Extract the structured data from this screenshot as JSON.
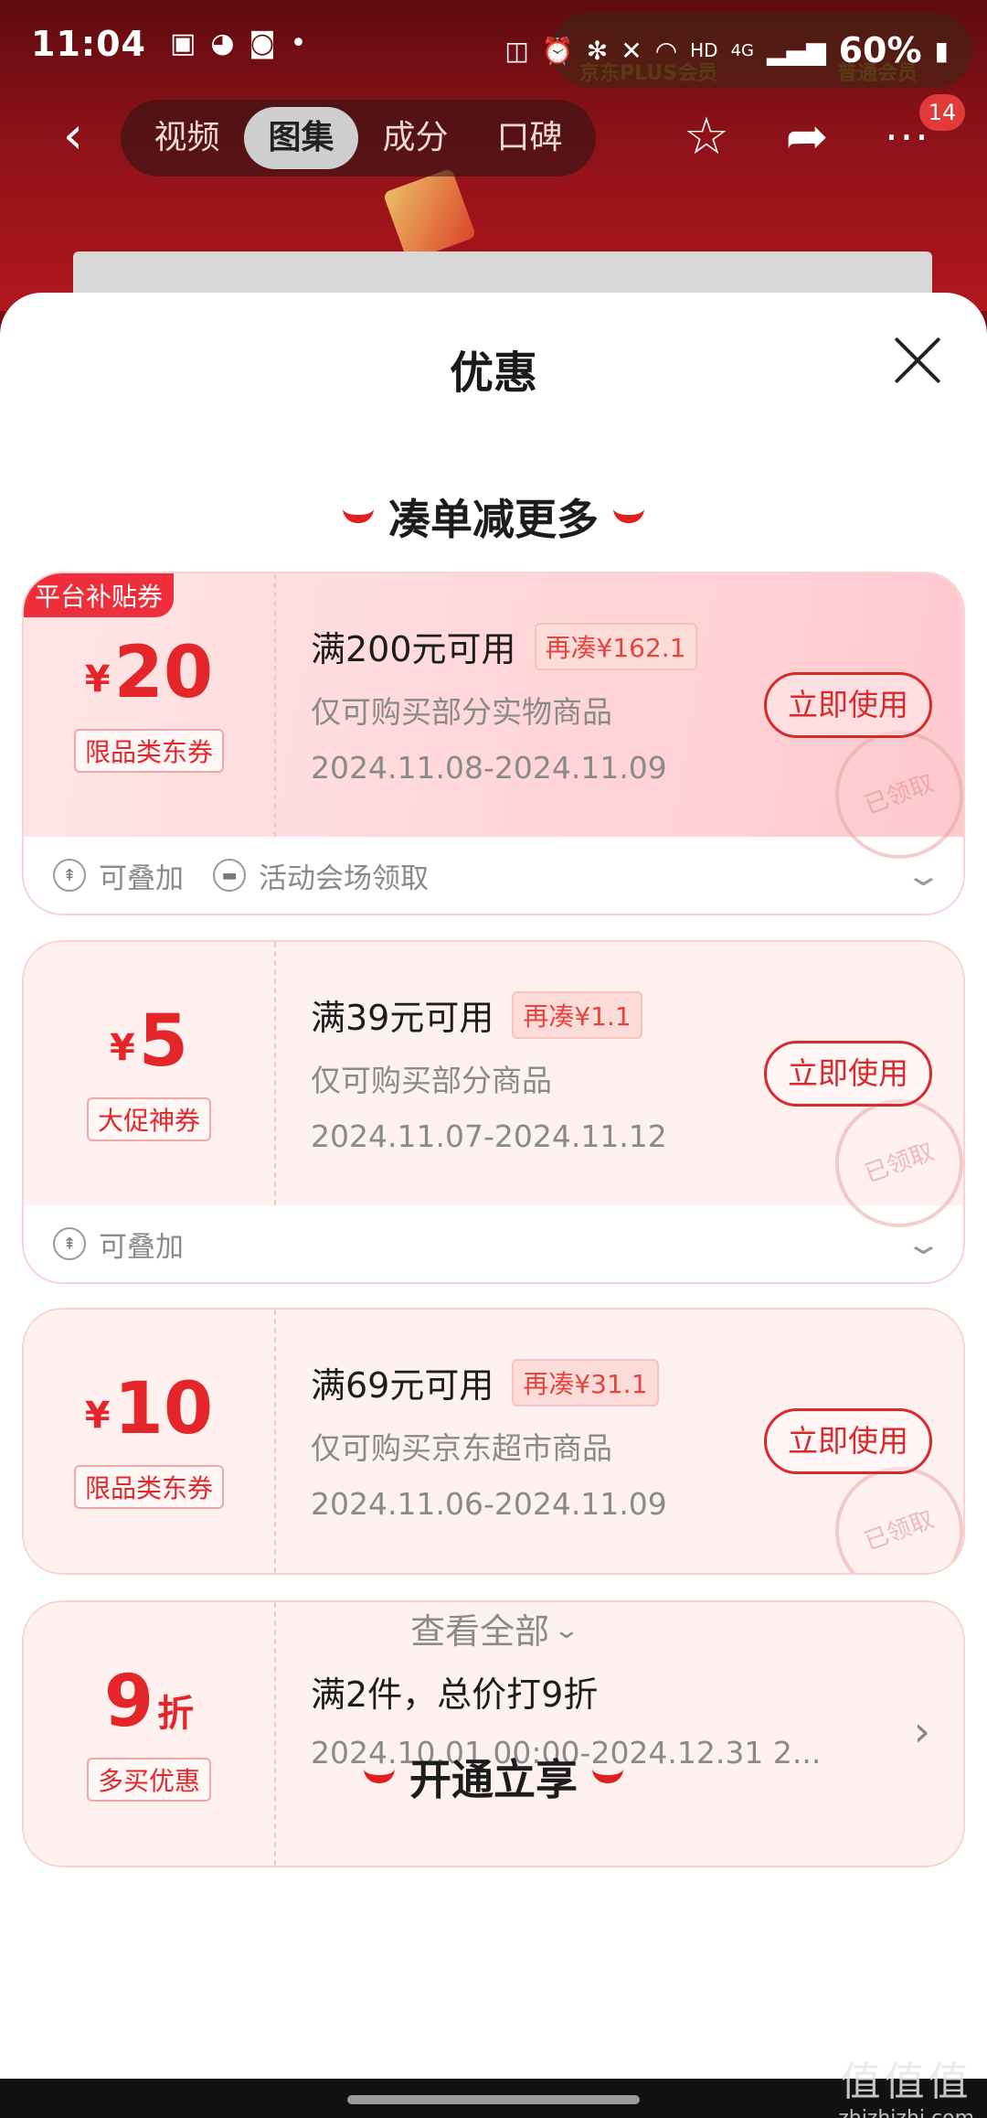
{
  "status_bar": {
    "time": "11:04",
    "battery": "60%",
    "network": "4G",
    "hd": "HD",
    "plus_label": "京东PLUS会员",
    "member_label": "普通会员"
  },
  "nav": {
    "tabs": [
      "视频",
      "图集",
      "成分",
      "口碑"
    ],
    "active_tab": "图集",
    "more_badge": "14"
  },
  "sheet": {
    "title": "优惠",
    "section1": "凑单减更多",
    "section2": "开通立享",
    "view_all": "查看全部"
  },
  "coupons": [
    {
      "corner": "平台补贴券",
      "yen": "¥",
      "amount": "20",
      "type": "限品类东券",
      "condition": "满200元可用",
      "need": "再凑¥162.1",
      "desc": "仅可购买部分实物商品",
      "date": "2024.11.08-2024.11.09",
      "button": "立即使用",
      "stamp": "已领取",
      "foot": [
        "可叠加",
        "活动会场领取"
      ]
    },
    {
      "yen": "¥",
      "amount": "5",
      "type": "大促神券",
      "condition": "满39元可用",
      "need": "再凑¥1.1",
      "desc": "仅可购买部分商品",
      "date": "2024.11.07-2024.11.12",
      "button": "立即使用",
      "stamp": "已领取",
      "foot": [
        "可叠加"
      ]
    },
    {
      "yen": "¥",
      "amount": "10",
      "type": "限品类东券",
      "condition": "满69元可用",
      "need": "再凑¥31.1",
      "desc": "仅可购买京东超市商品",
      "date": "2024.11.06-2024.11.09",
      "button": "立即使用",
      "stamp": "已领取"
    },
    {
      "amount": "9",
      "unit": "折",
      "type": "多买优惠",
      "condition": "满2件，总价打9折",
      "date": "2024.10.01 00:00-2024.12.31 2..."
    }
  ],
  "watermark": {
    "big": "值值值",
    "small": "zhizhizhi.com"
  },
  "colors": {
    "accent": "#e4262a",
    "coupon_bg": "#fff1f0",
    "header_bg": "#8e1218"
  }
}
